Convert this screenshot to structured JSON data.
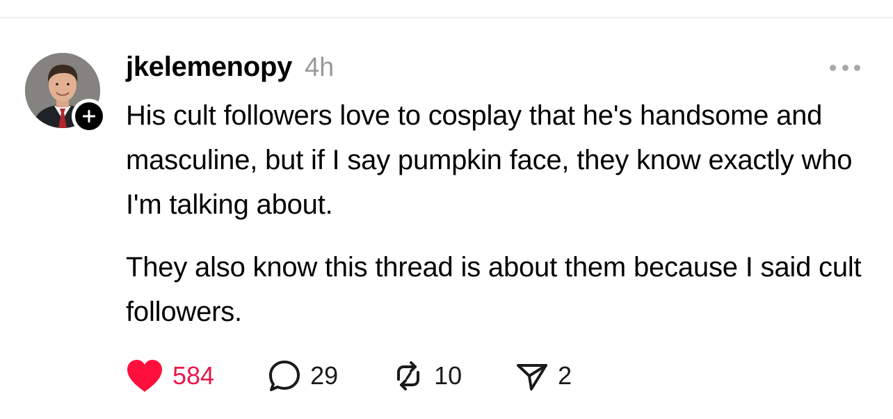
{
  "post": {
    "username": "jkelemenopy",
    "timestamp": "4h",
    "paragraphs": [
      "His cult followers love to cosplay that he's handsome and masculine, but if I say pumpkin face, they know exactly who I'm talking about.",
      "They also know this thread is about them because I said cult followers."
    ]
  },
  "actions": {
    "likes": "584",
    "replies": "29",
    "reposts": "10",
    "shares": "2"
  },
  "colors": {
    "like_accent": "#e8174a",
    "timestamp": "#999999",
    "text": "#000000"
  },
  "icons": {
    "like": "heart-icon",
    "reply": "speech-bubble-icon",
    "repost": "repost-arrows-icon",
    "share": "paper-plane-icon",
    "more": "ellipsis-icon",
    "follow": "plus-icon"
  }
}
